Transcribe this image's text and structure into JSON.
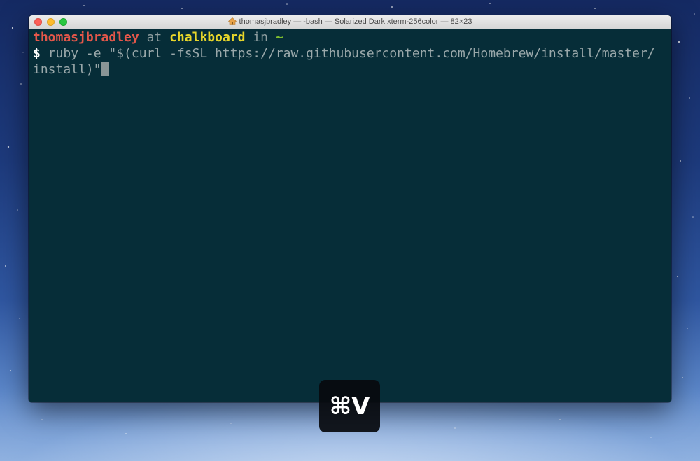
{
  "window": {
    "title": "thomasjbradley — -bash — Solarized Dark xterm-256color — 82×23"
  },
  "prompt": {
    "user": "thomasjbradley",
    "at": "at",
    "host": "chalkboard",
    "in": "in",
    "dir": "~",
    "symbol": "$"
  },
  "command": {
    "line1": "ruby -e \"$(curl -fsSL https://raw.githubusercontent.com/Homebrew/install/master/",
    "line2": "install)\""
  },
  "keystroke": {
    "label": "⌘V"
  },
  "colors": {
    "terminal_bg": "#062d38",
    "user": "#e4574a",
    "host": "#e8d62a",
    "dir": "#7fbf2f"
  }
}
